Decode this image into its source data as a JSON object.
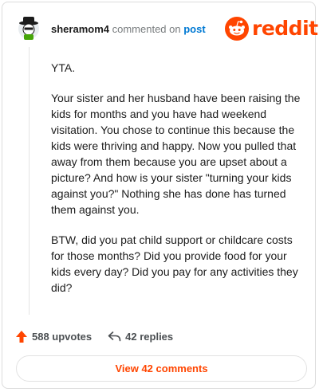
{
  "header": {
    "username": "sheramom4",
    "commented_on": "commented on",
    "post_link": "post",
    "logo_text": "reddit"
  },
  "comment": {
    "paragraphs": [
      "YTA.",
      "Your sister and her husband have been raising the kids for months and you have had weekend visitation. You chose to continue this because the kids were thriving and happy. Now you pulled that away from them because you are upset about a picture? And how is your sister \"turning your kids against you?\" Nothing she has done has turned them against you.",
      "BTW, did you pat child support or childcare costs for those months? Did you provide food for your kids every day? Did you pay for any activities they did?"
    ]
  },
  "actions": {
    "upvotes_label": "588 upvotes",
    "replies_label": "42 replies"
  },
  "view_comments_label": "View 42 comments",
  "colors": {
    "brand": "#ff4500",
    "link": "#0079d3",
    "muted": "#787c7e"
  },
  "icons": [
    "avatar",
    "reddit-snoo-icon",
    "upvote-arrow-icon",
    "reply-arrow-icon"
  ]
}
